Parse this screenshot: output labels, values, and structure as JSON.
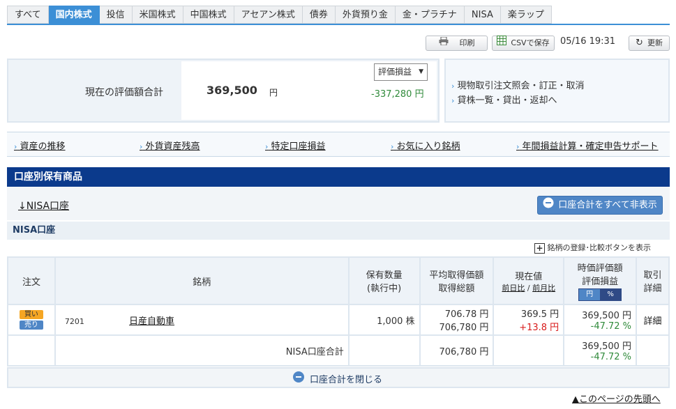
{
  "tabs": [
    "すべて",
    "国内株式",
    "投信",
    "米国株式",
    "中国株式",
    "アセアン株式",
    "債券",
    "外貨預り金",
    "金・プラチナ",
    "NISA",
    "楽ラップ"
  ],
  "toolbar": {
    "print": "印刷",
    "csv": "CSVで保存",
    "timestamp": "05/16 19:31",
    "refresh": "更新"
  },
  "summary": {
    "label": "現在の評価額合計",
    "value": "369,500",
    "unit": "円",
    "select": "評価損益",
    "gain": "-337,280 円"
  },
  "side_links": [
    "現物取引注文照会・訂正・取消",
    "貸株一覧・貸出・返却へ"
  ],
  "nav_links": [
    "資産の推移",
    "外貨資産残高",
    "特定口座損益",
    "お気に入り銘柄",
    "年間損益計算・確定申告サポート"
  ],
  "section": {
    "title": "口座別保有商品",
    "anchor": "↓NISA口座",
    "hide_all": "口座合計をすべて非表示",
    "subhead": "NISA口座",
    "add_compare": "銘柄の登録･比較ボタンを表示"
  },
  "table": {
    "headers": {
      "order": "注文",
      "name": "銘柄",
      "qty1": "保有数量",
      "qty2": "(執行中)",
      "avg1": "平均取得価額",
      "avg2": "取得総額",
      "cur1": "現在値",
      "cur2": "前日比",
      "cur3": "前月比",
      "val1": "時価評価額",
      "val2": "評価損益",
      "yen": "円",
      "pct": "%",
      "det1": "取引",
      "det2": "詳細"
    },
    "row": {
      "buy": "買い",
      "sell": "売り",
      "code": "7201",
      "name": "日産自動車",
      "qty": "1,000 株",
      "avg_price": "706.78 円",
      "cost": "706,780 円",
      "current": "369.5 円",
      "change": "+13.8 円",
      "valuation": "369,500 円",
      "gl_pct": "-47.72 %",
      "detail": "詳細"
    },
    "total": {
      "label": "NISA口座合計",
      "cost": "706,780 円",
      "valuation": "369,500 円",
      "gl_pct": "-47.72 %"
    }
  },
  "close_total": "口座合計を閉じる",
  "page_top": "▲このページの先頭へ"
}
